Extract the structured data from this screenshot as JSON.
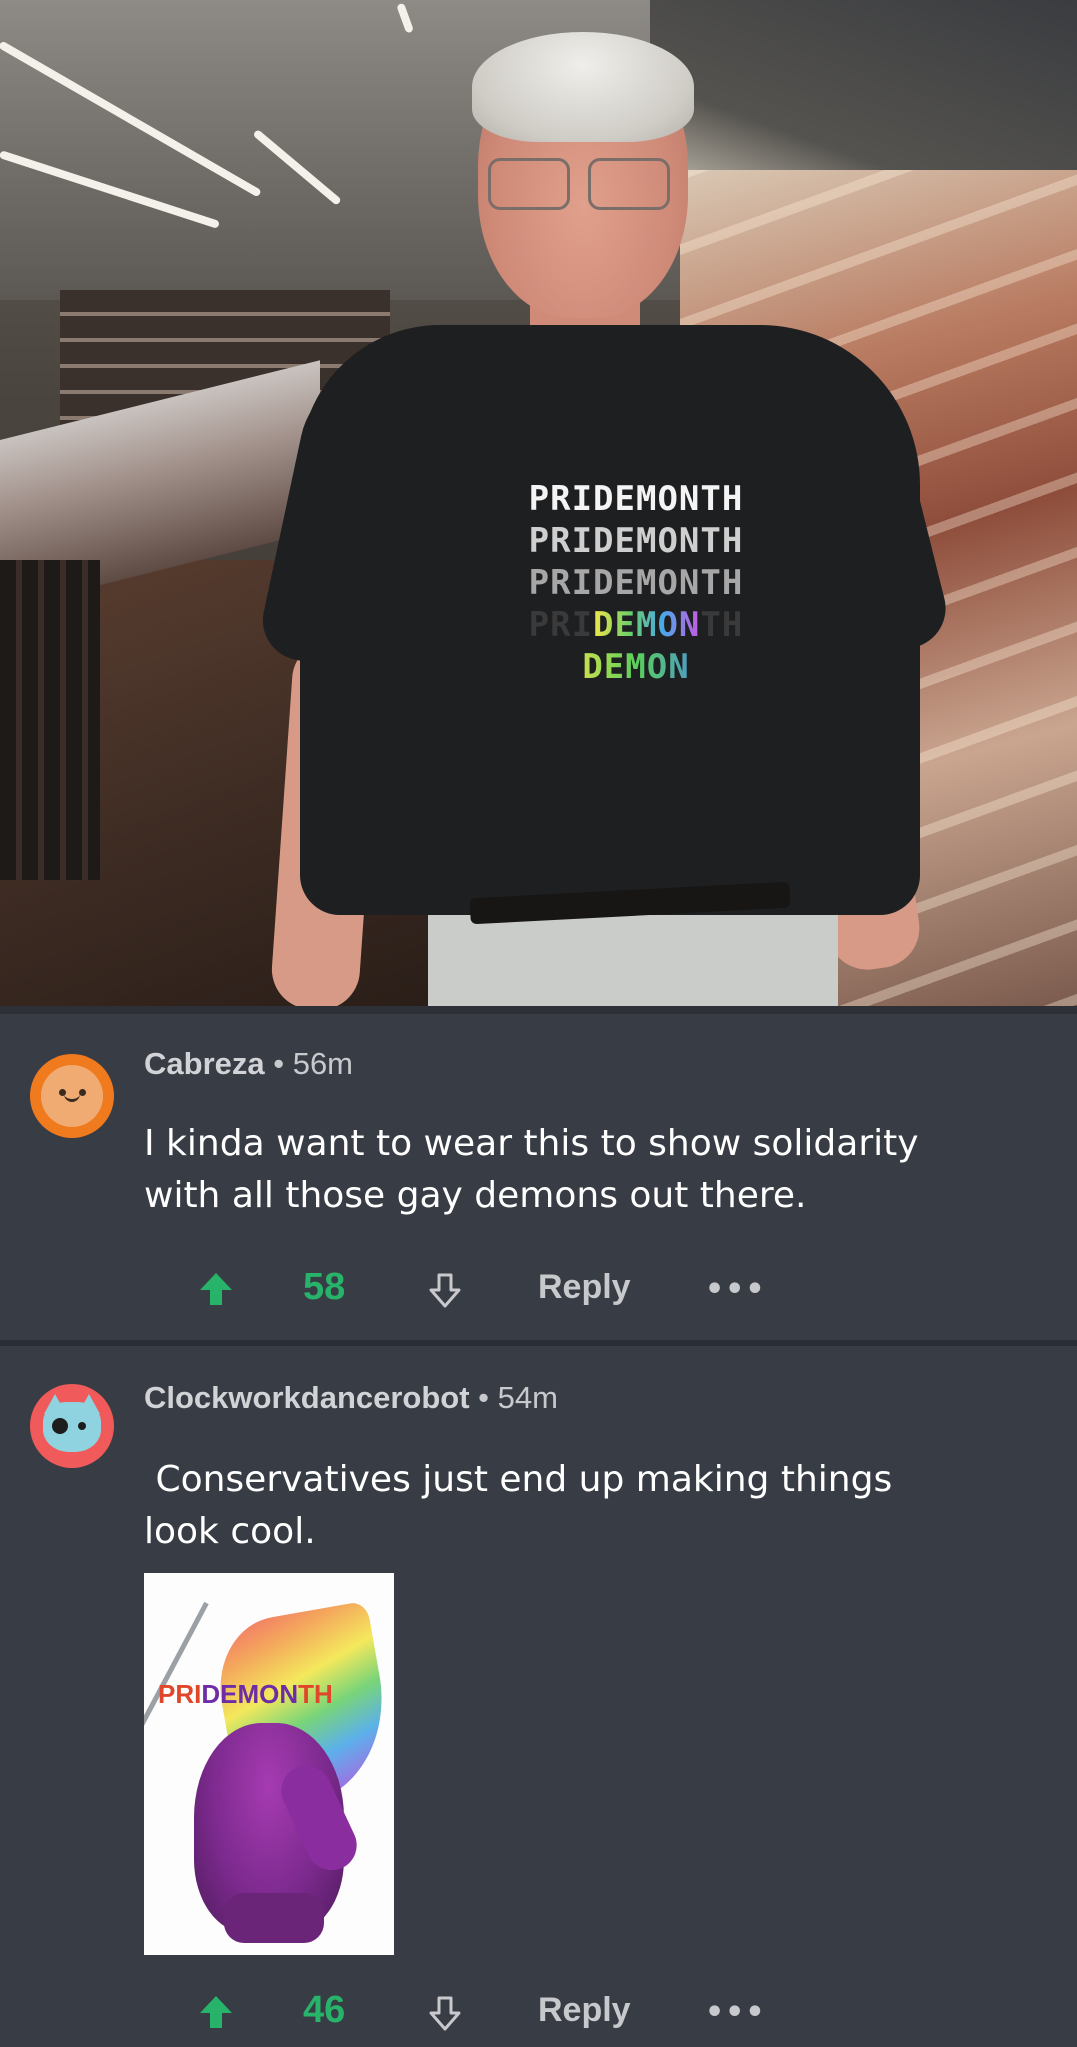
{
  "photo": {
    "shirt_lines": [
      "PRIDEMONTH",
      "PRIDEMONTH",
      "PRIDEMONTH"
    ],
    "shirt_line4": {
      "start": "PRI",
      "middle": "DEMON",
      "end": "TH"
    },
    "shirt_line5": "DEMON"
  },
  "comments": [
    {
      "author": "Cabreza",
      "separator": " • ",
      "time": "56m",
      "body_line1": "I kinda want to wear this to show solidarity",
      "body_line2": "with all those gay demons out there.",
      "score": "58",
      "reply_label": "Reply",
      "more_label": "•••",
      "avatar_icon": "orange-face-avatar-icon"
    },
    {
      "author": "Clockworkdancerobot",
      "separator": " • ",
      "time": "54m",
      "body_line1": " Conservatives just end up making things",
      "body_line2": "look cool.",
      "score": "46",
      "reply_label": "Reply",
      "more_label": "•••",
      "avatar_icon": "blue-cat-avatar-icon",
      "attachment": {
        "title_start": "PRI",
        "title_middle": "DEMON",
        "title_end": "TH"
      }
    }
  ],
  "colors": {
    "background": "#383c44",
    "upvote_green": "#27b36a",
    "text": "#ffffff",
    "meta_text": "#c8c9cc"
  }
}
